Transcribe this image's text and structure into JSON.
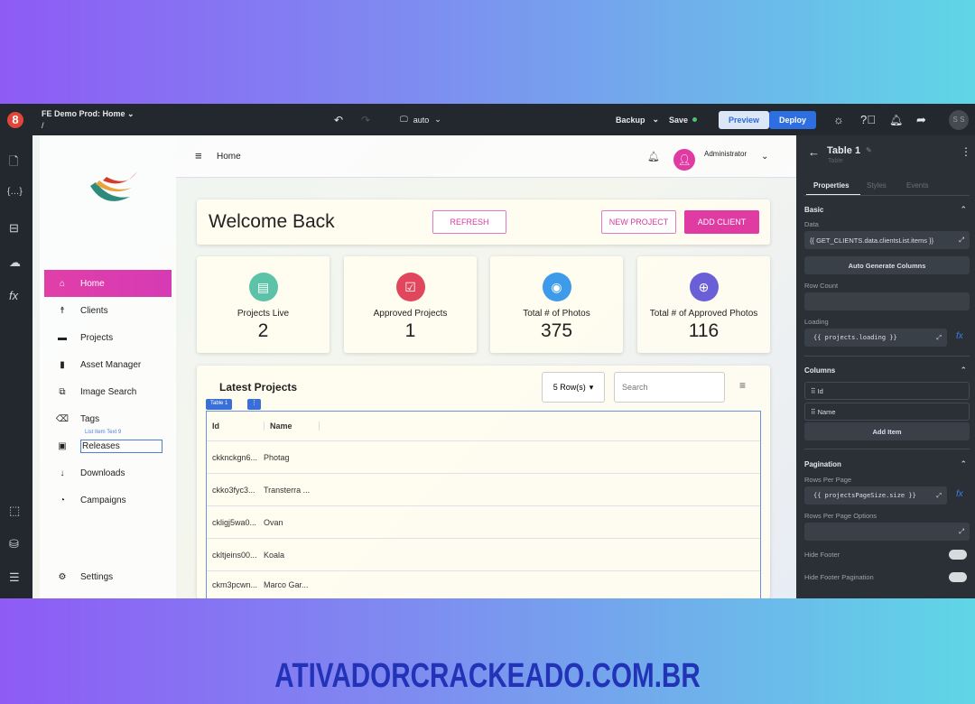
{
  "topbar": {
    "app_title": "FE Demo Prod: Home",
    "path": "/",
    "viewport": "auto",
    "backup": "Backup",
    "save": "Save",
    "preview": "Preview",
    "deploy": "Deploy",
    "avatar": "S S",
    "logo": "8"
  },
  "sidebar": {
    "items": [
      {
        "label": "Home",
        "icon": "home-icon"
      },
      {
        "label": "Clients",
        "icon": "person-icon"
      },
      {
        "label": "Projects",
        "icon": "inbox-icon"
      },
      {
        "label": "Asset Manager",
        "icon": "book-icon"
      },
      {
        "label": "Image Search",
        "icon": "image-search-icon"
      },
      {
        "label": "Tags",
        "icon": "tag-icon"
      },
      {
        "label": "Releases",
        "icon": "contact-icon"
      },
      {
        "label": "Downloads",
        "icon": "download-icon"
      },
      {
        "label": "Campaigns",
        "icon": "speed-icon"
      }
    ],
    "settings": "Settings",
    "selection_tag": "List Item Text 9"
  },
  "header": {
    "title": "Home",
    "user": "Administrator"
  },
  "welcome": {
    "title": "Welcome Back",
    "refresh": "REFRESH",
    "new_project": "NEW PROJECT",
    "add_client": "ADD CLIENT"
  },
  "stats": [
    {
      "label": "Projects Live",
      "value": "2",
      "color": "#5cc3a8"
    },
    {
      "label": "Approved Projects",
      "value": "1",
      "color": "#e0465c"
    },
    {
      "label": "Total # of Photos",
      "value": "375",
      "color": "#3d9be9"
    },
    {
      "label": "Total # of Approved Photos",
      "value": "116",
      "color": "#6a5fd6"
    }
  ],
  "projects": {
    "title": "Latest Projects",
    "rows_select": "5 Row(s)",
    "search_placeholder": "Search",
    "table_tag": "Table 1",
    "columns": [
      "Id",
      "Name"
    ],
    "rows": [
      [
        "ckknckgn6...",
        "Photag"
      ],
      [
        "ckko3fyc3...",
        "Transterra ..."
      ],
      [
        "ckligj5wa0...",
        "Ovan"
      ],
      [
        "ckltjeins00...",
        "Koala"
      ],
      [
        "ckm3pcwn...",
        "Marco Gar..."
      ]
    ]
  },
  "panel": {
    "title": "Table 1",
    "subtitle": "Table",
    "tabs": [
      "Properties",
      "Styles",
      "Events"
    ],
    "basic": "Basic",
    "data_label": "Data",
    "data_value": "{{ GET_CLIENTS.data.clientsList.items }}",
    "auto_generate": "Auto Generate Columns",
    "row_count": "Row Count",
    "loading_label": "Loading",
    "loading_value": "{{ projects.loading }}",
    "columns": "Columns",
    "column_items": [
      "Id",
      "Name"
    ],
    "add_item": "Add Item",
    "pagination": "Pagination",
    "rows_per_page": "Rows Per Page",
    "rows_per_page_value": "{{ projectsPageSize.size }}",
    "rows_per_page_options": "Rows Per Page Options",
    "hide_footer": "Hide Footer",
    "hide_footer_pagination": "Hide Footer Pagination",
    "hide_footer_on": false,
    "hide_footer_pagination_on": false
  },
  "watermark": "ATIVADORCRACKEADO.COM.BR"
}
